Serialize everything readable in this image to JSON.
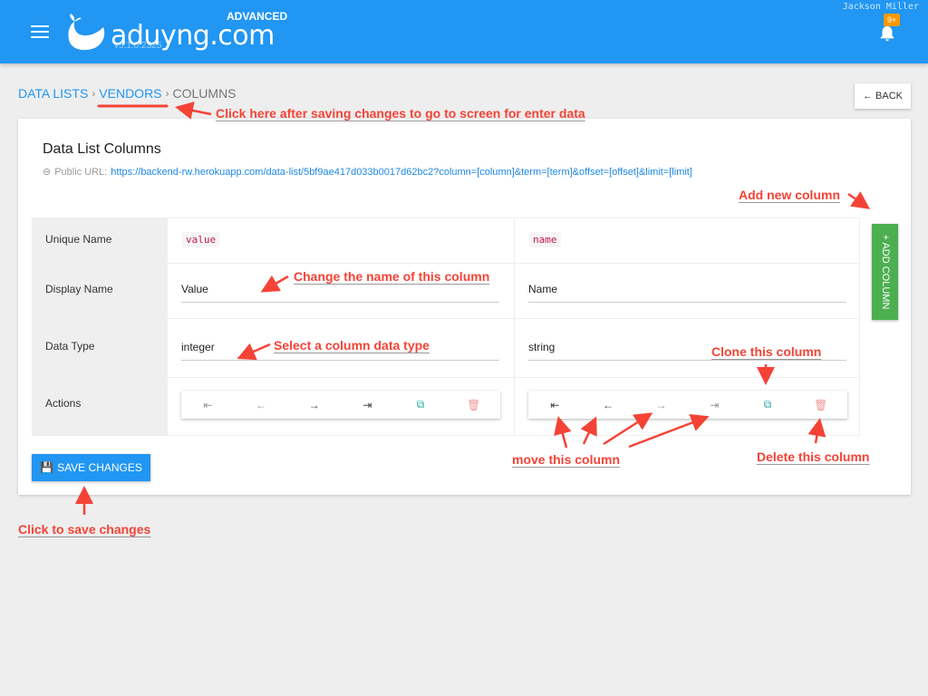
{
  "header": {
    "brand": "aduyng.com",
    "tier": "ADVANCED",
    "version": "v5.1.0.2325",
    "user": "Jackson Miller",
    "notification_badge": "9+",
    "color": "#2196f3"
  },
  "breadcrumb": {
    "items": [
      "DATA LISTS",
      "VENDORS",
      "COLUMNS"
    ]
  },
  "back_label": "BACK",
  "card": {
    "title": "Data List Columns",
    "public_url_label": "Public URL:",
    "public_url": "https://backend-rw.herokuapp.com/data-list/5bf9ae417d033b0017d62bc2?column=[column]&term=[term]&offset=[offset]&limit=[limit]"
  },
  "rows": {
    "unique_name": "Unique Name",
    "display_name": "Display Name",
    "data_type": "Data Type",
    "actions": "Actions"
  },
  "columns": [
    {
      "unique_name": "value",
      "display_name": "Value",
      "data_type": "integer"
    },
    {
      "unique_name": "name",
      "display_name": "Name",
      "data_type": "string"
    }
  ],
  "action_icons": [
    "move-first-icon",
    "move-left-icon",
    "move-right-icon",
    "move-last-icon",
    "clone-icon",
    "delete-icon"
  ],
  "add_column_label": "+ ADD COLUMN",
  "save_label": "SAVE CHANGES",
  "annotations": {
    "back_note": "Click here after saving changes to go to screen for enter data",
    "add_note": "Add new column",
    "rename_note": "Change the name of this column",
    "type_note": "Select a column data type",
    "clone_note": "Clone this column",
    "move_note": "move this column",
    "delete_note": "Delete this column",
    "save_note": "Click to save changes"
  },
  "colors": {
    "accent": "#2196f3",
    "add": "#4caf50",
    "annotation": "#f44336"
  }
}
